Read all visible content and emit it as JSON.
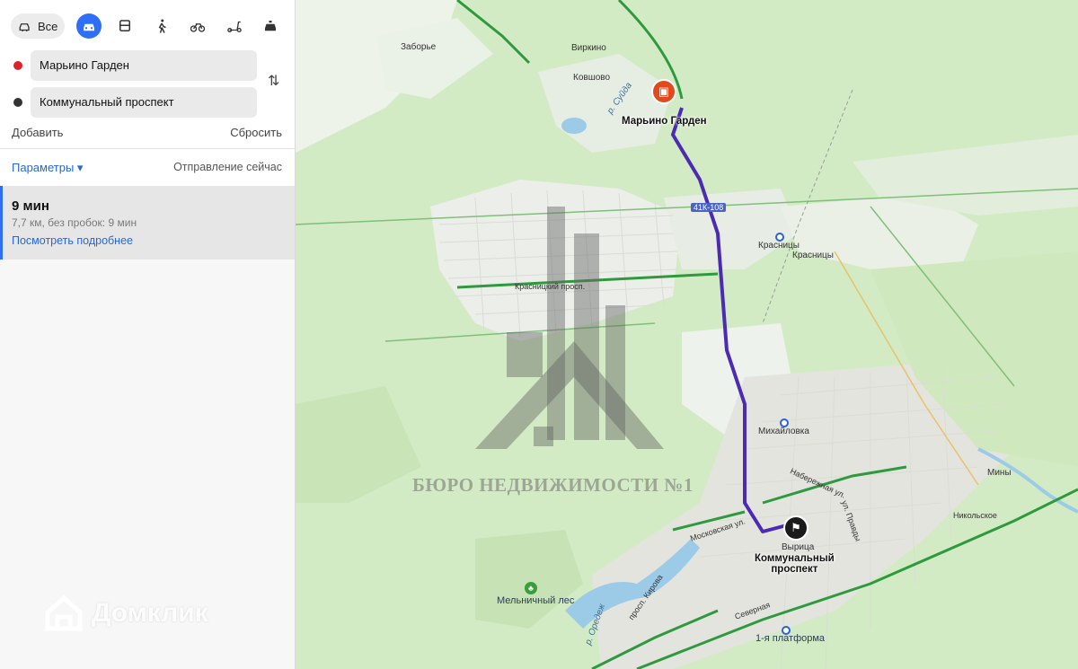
{
  "modes": {
    "all_label": "Все"
  },
  "route_form": {
    "from": "Марьино Гарден",
    "to": "Коммунальный проспект",
    "add": "Добавить",
    "reset": "Сбросить",
    "params": "Параметры ▾",
    "departure": "Отправление сейчас"
  },
  "route": {
    "time": "9 мин",
    "details": "7,7 км, без пробок: 9 мин",
    "more": "Посмотреть подробнее"
  },
  "brand": "Домклик",
  "watermark": "БЮРО НЕДВИЖИМОСТИ №1",
  "map": {
    "places": {
      "zaborye": "Заборье",
      "virkino": "Виркино",
      "kovshovo": "Ковшово",
      "krasnitsy_station": "Красницы",
      "krasnitsy": "Красницы",
      "mikhaylovka": "Михайловка",
      "miny": "Мины",
      "nikolskoe": "Никольское",
      "vyritsa": "Вырица",
      "platform": "1-я платформа",
      "melnichny": "Мельничный лес"
    },
    "streets": {
      "krasnitsky": "Красницкий просп.",
      "moskovskaya": "Московская ул.",
      "naberezhnaya": "Набережная ул.",
      "pravdy": "ул. Правды",
      "kirova": "просп. Кирова",
      "severnaya": "Северная",
      "river_suyda": "р. Суйда",
      "river_oredezh": "р. Оредеж"
    },
    "road_badge": "41К-108",
    "start_label": "Марьино Гарден",
    "end_label": "Коммунальный\nпроспект",
    "colors": {
      "route": "#4b2bb5",
      "start_pin": "#e04a1c",
      "end_pin": "#1a1a1a",
      "road": "#2f9a3d"
    }
  }
}
